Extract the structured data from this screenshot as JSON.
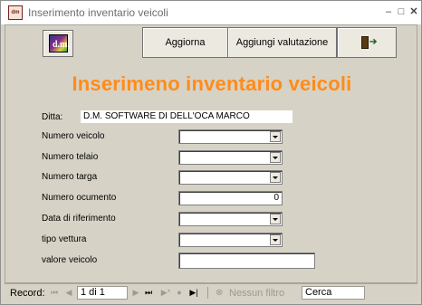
{
  "window": {
    "title": "Inserimento inventario veicoli",
    "app_icon_text": "dm",
    "minimize_glyph": "‒",
    "maximize_glyph": "□",
    "close_glyph": "✕"
  },
  "toolbar": {
    "logo_text": "d.m.",
    "aggiorna_label": "Aggiorna",
    "aggiungi_label": "Aggiungi valutazione",
    "exit_icon": "exit-door-icon"
  },
  "form": {
    "heading": "Inserimeno inventario veicoli",
    "ditta_label": "Ditta:",
    "ditta_value": "D.M. SOFTWARE DI DELL'OCA MARCO",
    "fields": [
      {
        "label": "Numero veicolo",
        "type": "combo",
        "value": ""
      },
      {
        "label": "Numero telaio",
        "type": "combo",
        "value": ""
      },
      {
        "label": "Numero targa",
        "type": "combo",
        "value": ""
      },
      {
        "label": "Numero ocumento",
        "type": "text",
        "value": "0"
      },
      {
        "label": "Data di riferimento",
        "type": "combo",
        "value": ""
      },
      {
        "label": "tipo vettura",
        "type": "combo",
        "value": ""
      },
      {
        "label": "valore veicolo",
        "type": "text",
        "value": ""
      }
    ]
  },
  "navbar": {
    "record_label": "Record:",
    "first_glyph": "⏮",
    "prev_glyph": "◀",
    "counter": "1 di 1",
    "next_glyph": "▶",
    "last_glyph": "⏭",
    "new_glyph": "▶*",
    "filter_glyph": "⊗",
    "filter_label": "Nessun filtro",
    "search_label": "Cerca"
  },
  "colors": {
    "heading": "#ff8c1a",
    "form_background": "#d6d2c6"
  }
}
